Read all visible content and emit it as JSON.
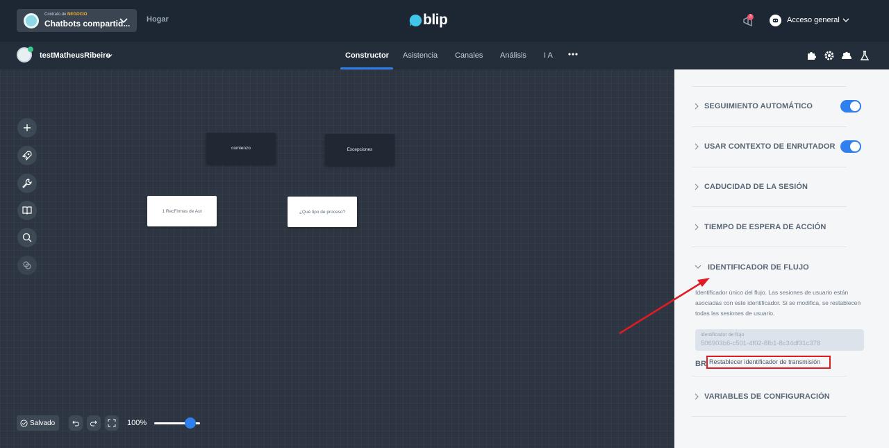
{
  "topbar": {
    "contract_prefix": "Contrato de",
    "contract_tag": "NEGOCIO",
    "contract_name": "Chatbots compartid...",
    "home_label": "Hogar",
    "logo_text": "blip",
    "notification_count": "3",
    "account_label": "Acceso general"
  },
  "subnav": {
    "bot_name": "testMatheusRibeiro",
    "tabs": [
      {
        "label": "Constructor",
        "active": true
      },
      {
        "label": "Asistencia",
        "active": false
      },
      {
        "label": "Canales",
        "active": false
      },
      {
        "label": "Análisis",
        "active": false
      },
      {
        "label": "I A",
        "active": false
      }
    ]
  },
  "canvas": {
    "nodes": [
      {
        "label": "comienzo",
        "style": "dark"
      },
      {
        "label": "Excepciones",
        "style": "dark"
      },
      {
        "label": "1 RecFirmas de Aut",
        "style": "light"
      },
      {
        "label": "¿Qué tipo de proceso?",
        "style": "light"
      }
    ],
    "saved_label": "Salvado",
    "zoom_label": "100%",
    "zoom_level": 1.0
  },
  "panel": {
    "sections": [
      {
        "title": "SEGUIMIENTO AUTOMÁTICO",
        "toggle": true
      },
      {
        "title": "USAR CONTEXTO DE ENRUTADOR",
        "toggle": true
      },
      {
        "title": "CADUCIDAD DE LA SESIÓN"
      },
      {
        "title": "TIEMPO DE ESPERA DE ACCIÓN"
      },
      {
        "title": "IDENTIFICADOR DE FLUJO",
        "expanded": true
      },
      {
        "title": "VARIABLES DE CONFIGURACIÓN"
      }
    ],
    "flow_id": {
      "description": "Identificador único del flujo. Las sesiones de usuario están asociadas con este identificador. Si se modifica, se restablecen todas las sesiones de usuario.",
      "field_label": "identificador de flujo",
      "field_value": "506903b6-c501-4f02-8fb1-8c34df31c378",
      "fragment": "BR",
      "reset_label": "Restablecer identificador de transmisión"
    }
  },
  "colors": {
    "accent": "#2f80ed",
    "topbar": "#1d2733",
    "annotation": "#e01b24"
  }
}
